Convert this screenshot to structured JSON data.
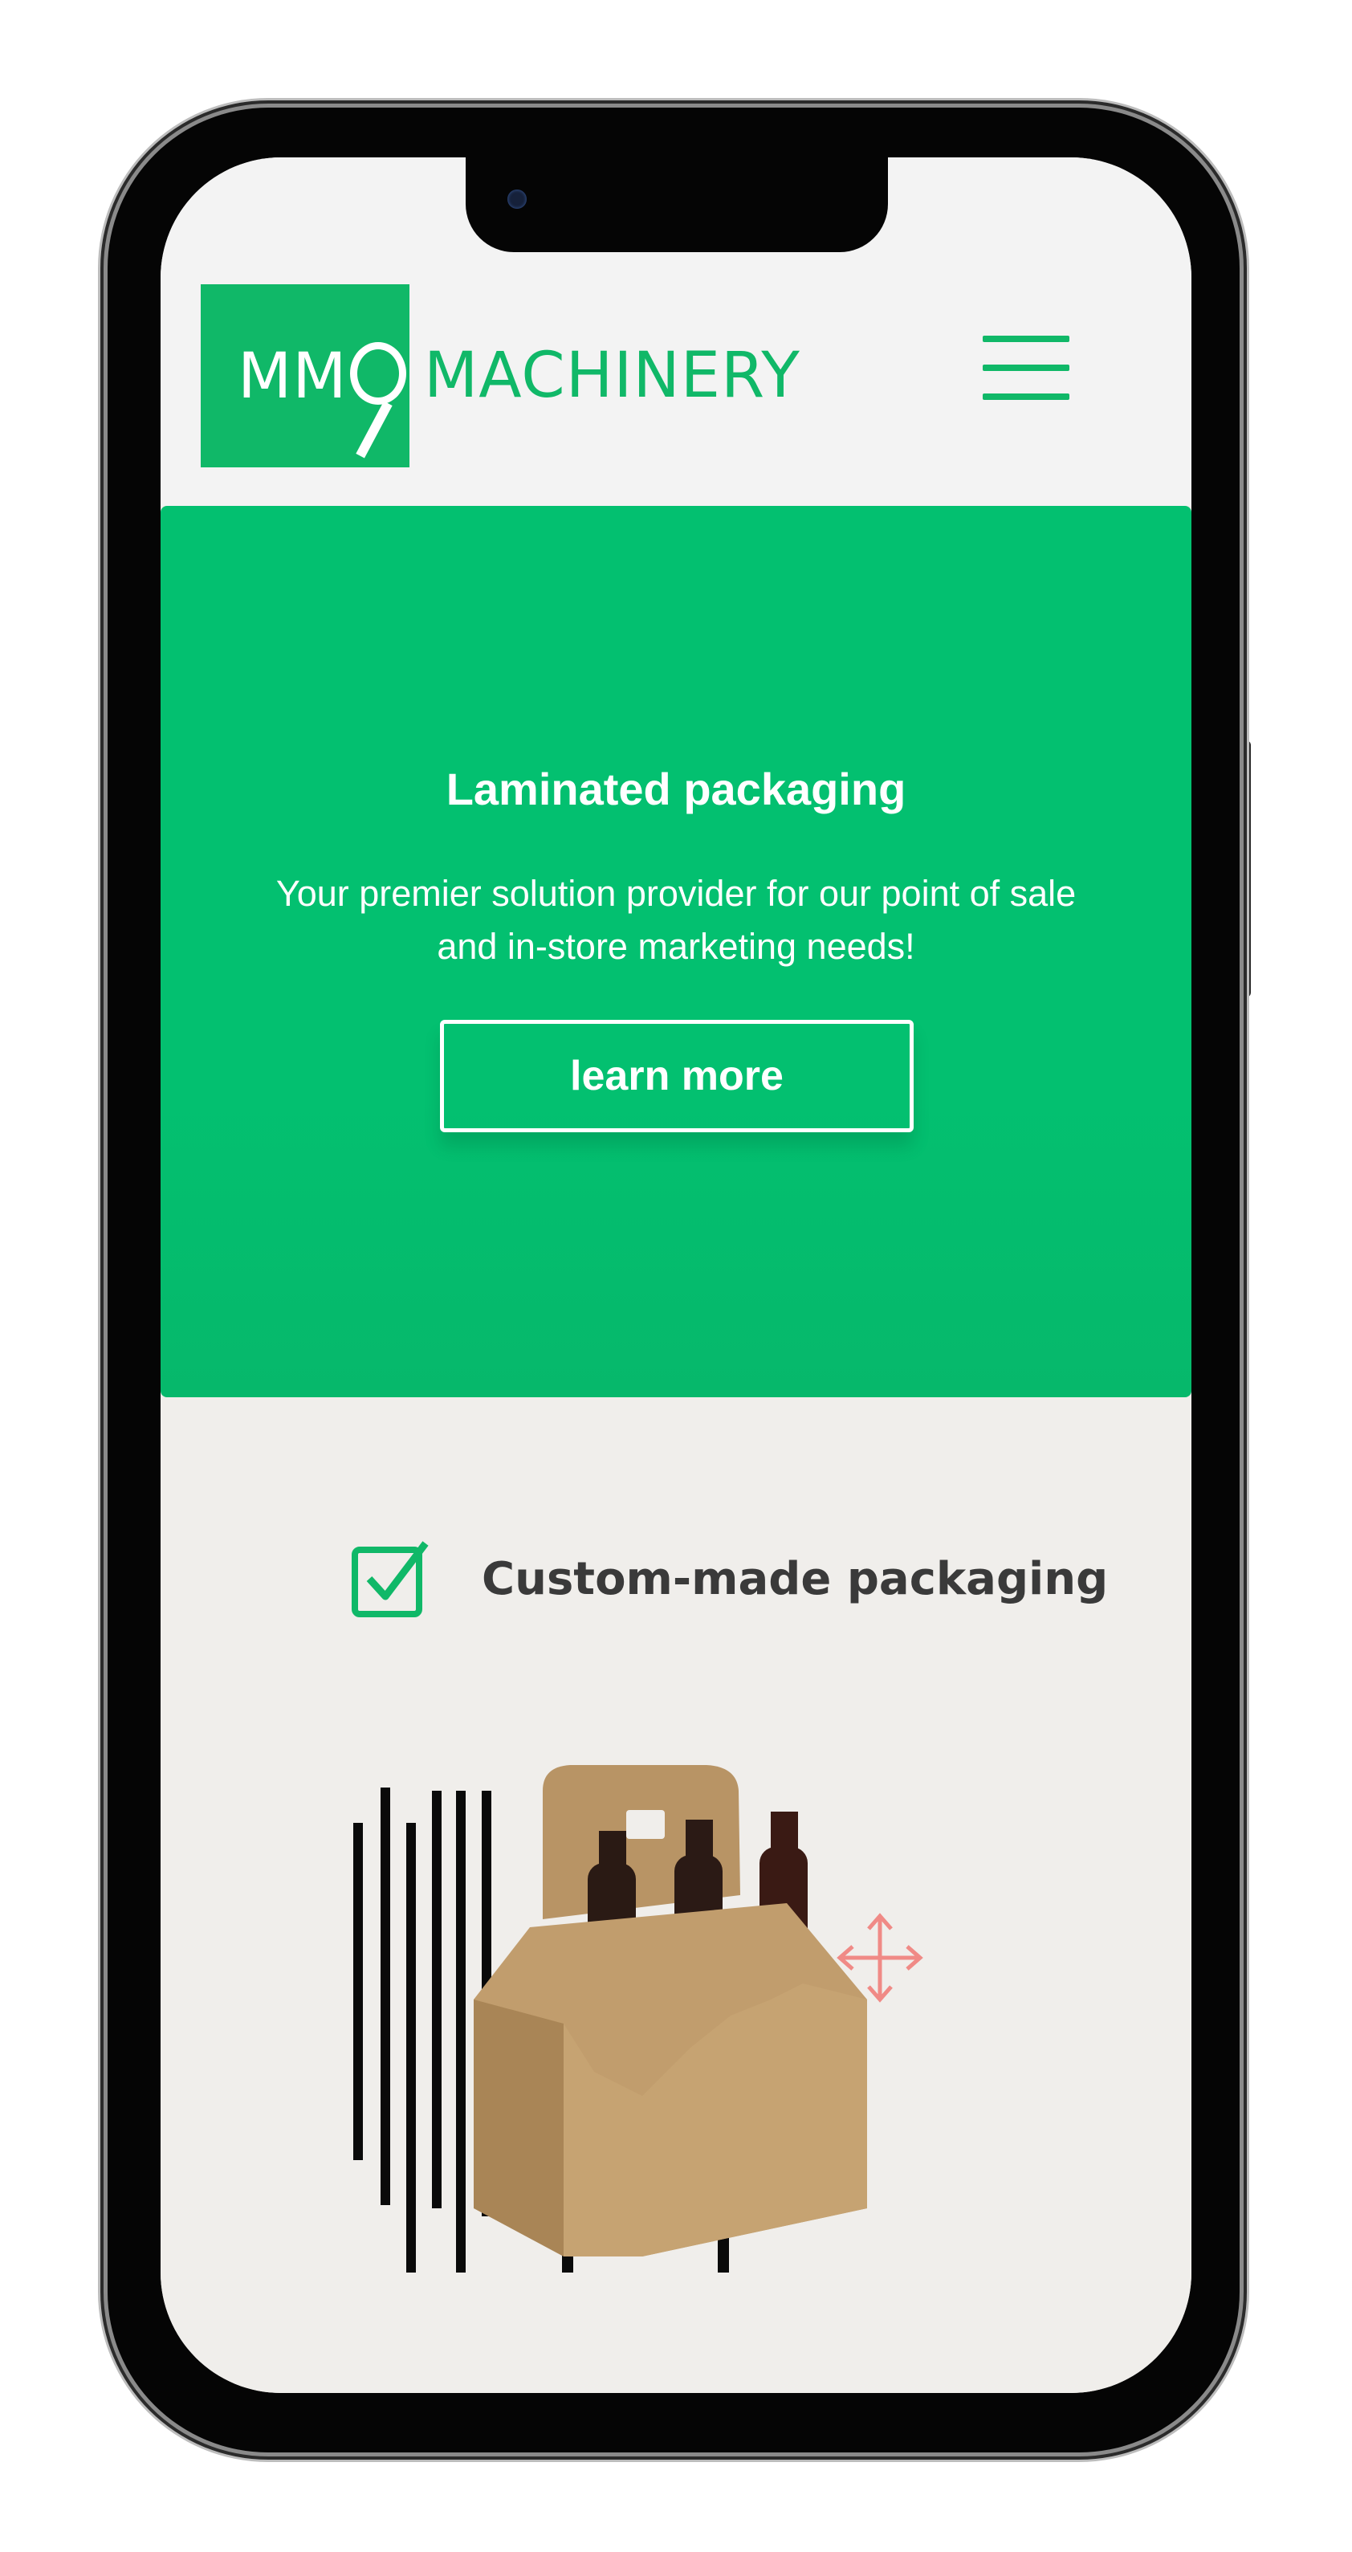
{
  "header": {
    "logo": {
      "mark_text": "MM",
      "brand_text": "MACHINERY"
    },
    "menu_icon": "hamburger-icon"
  },
  "hero": {
    "title": "Laminated packaging",
    "subtitle": "Your premier solution provider for our point of sale and in-store marketing needs!",
    "button_label": "learn more"
  },
  "features": [
    {
      "icon": "checkbox-check-icon",
      "label": "Custom-made packaging"
    }
  ],
  "product_image": {
    "icon": "bottle-carrier-illustration",
    "move_icon": "move-arrows-icon"
  },
  "colors": {
    "brand_green": "#10b868",
    "hero_green": "#03c070",
    "page_bg": "#f0eeeb",
    "header_bg": "#f3f3f3",
    "text_dark": "#3a3a3a"
  }
}
